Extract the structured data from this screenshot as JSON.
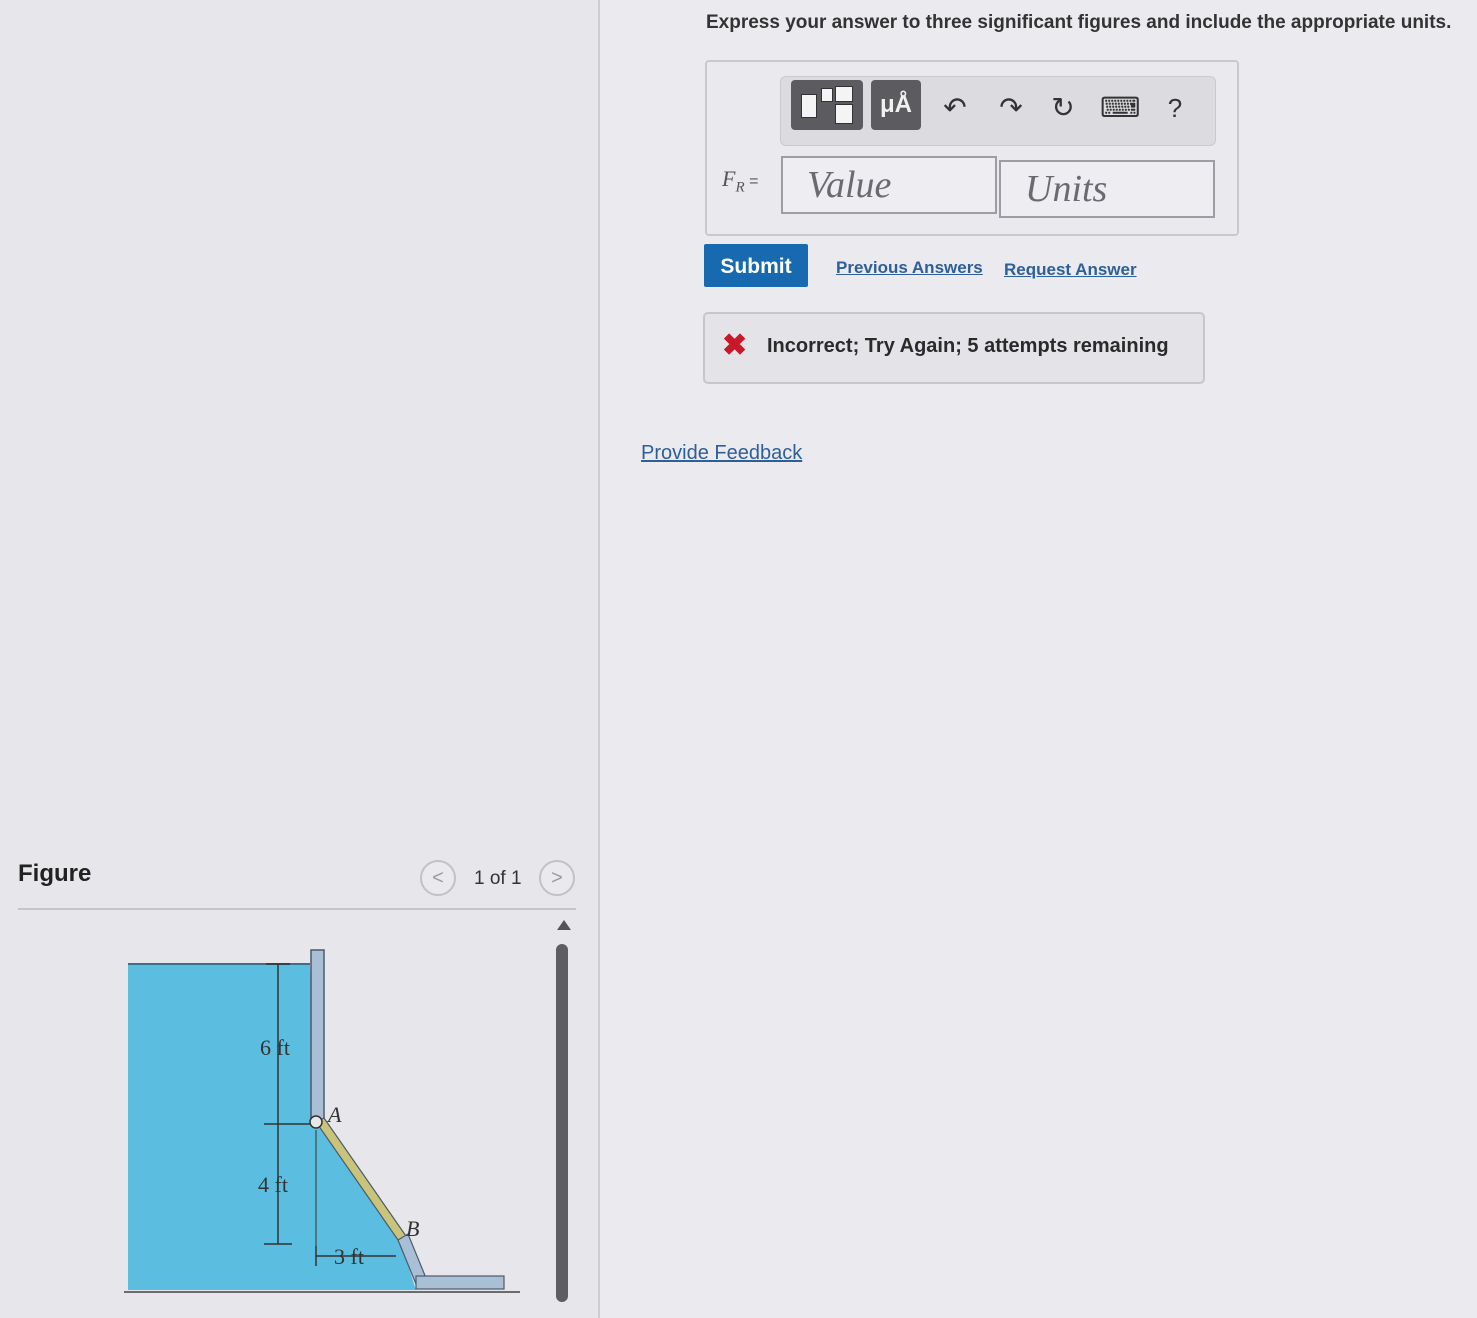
{
  "instructions": "Express your answer to three significant figures and include the appropriate units.",
  "toolbar": {
    "templates_icon": "templates-icon",
    "units_button_label": "μÅ",
    "undo_icon": "↶",
    "redo_icon": "↷",
    "reset_icon": "↻",
    "keyboard_icon": "⌨",
    "help_label": "?"
  },
  "answer": {
    "label_main": "F",
    "label_sub": "R",
    "label_eq": " =",
    "value_placeholder": "Value",
    "units_placeholder": "Units"
  },
  "actions": {
    "submit_label": "Submit",
    "previous_answers_label": "Previous Answers",
    "request_answer_label": "Request Answer"
  },
  "feedback": {
    "icon": "✖",
    "message": "Incorrect; Try Again; 5 attempts remaining"
  },
  "provide_feedback_label": "Provide Feedback",
  "figure": {
    "title": "Figure",
    "prev_label": "<",
    "next_label": ">",
    "page_indicator": "1 of 1",
    "labels": {
      "dim_top": "6 ft",
      "dim_bottom": "4 ft",
      "dim_horizontal": "3 ft",
      "point_a": "A",
      "point_b": "B"
    },
    "colors": {
      "water": "#5bbde0",
      "wall": "#a9bfd6",
      "gate": "#c9c47a"
    }
  }
}
